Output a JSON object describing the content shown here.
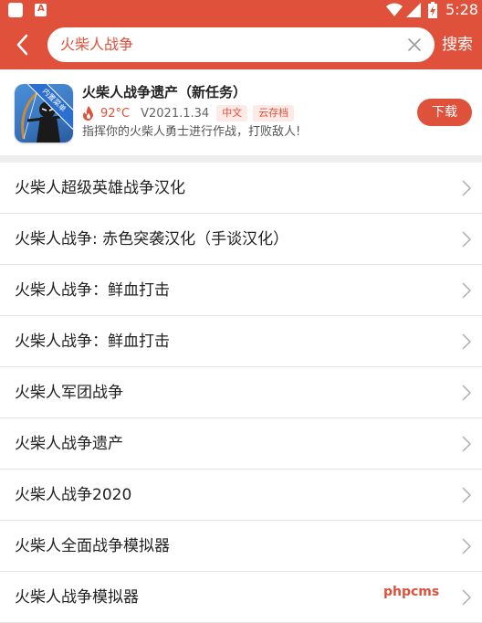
{
  "status_bar": {
    "time": "5:28",
    "icons": [
      "app-notification-icon",
      "font-a-icon",
      "wifi-icon",
      "signal-icon",
      "battery-charging-icon"
    ]
  },
  "header": {
    "back_icon": "chevron-left-icon",
    "search_value": "火柴人战争",
    "clear_icon": "close-icon",
    "search_label": "搜索"
  },
  "featured": {
    "title": "火柴人战争遗产（新任务）",
    "ribbon": "内置菜单",
    "temperature": "92°C",
    "version": "V2021.1.34",
    "tags": [
      "中文",
      "云存档"
    ],
    "description": "指挥你的火柴人勇士进行作战，打败敌人!",
    "download_label": "下载"
  },
  "results": [
    {
      "label": "火柴人超级英雄战争汉化"
    },
    {
      "label": "火柴人战争: 赤色突袭汉化（手谈汉化）"
    },
    {
      "label": "火柴人战争：鲜血打击"
    },
    {
      "label": "火柴人战争：鲜血打击"
    },
    {
      "label": "火柴人军团战争"
    },
    {
      "label": "火柴人战争遗产"
    },
    {
      "label": "火柴人战争2020"
    },
    {
      "label": "火柴人全面战争模拟器"
    },
    {
      "label": "火柴人战争模拟器"
    }
  ],
  "watermark": "phpcms",
  "colors": {
    "accent": "#e0513b",
    "tag_bg": "#fde9e6"
  }
}
